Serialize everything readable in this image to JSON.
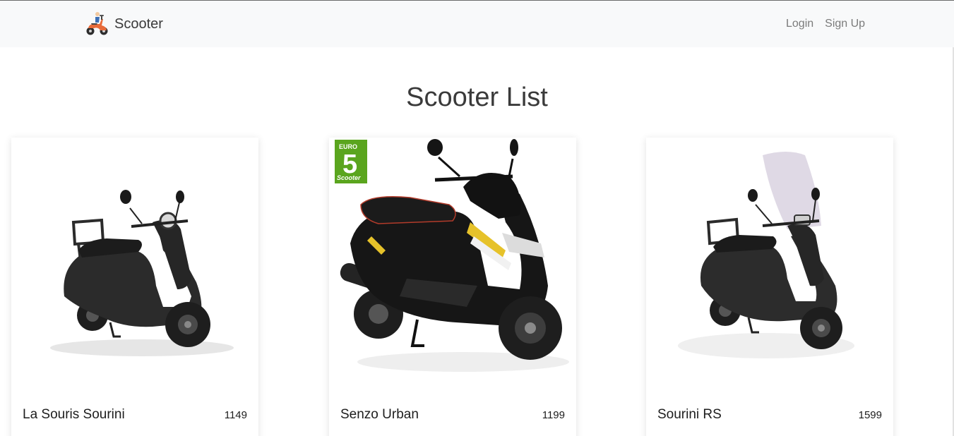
{
  "navbar": {
    "brand": "Scooter",
    "links": [
      "Login",
      "Sign Up"
    ]
  },
  "page": {
    "title": "Scooter List"
  },
  "scooters": [
    {
      "name": "La Souris Sourini",
      "price": "1149"
    },
    {
      "name": "Senzo Urban",
      "price": "1199",
      "badge": {
        "top": "EURO",
        "number": "5",
        "bottom": "Scooter"
      }
    },
    {
      "name": "Sourini RS",
      "price": "1599"
    }
  ],
  "colors": {
    "navbar_bg": "#f8f9fa",
    "badge_green": "#5aa51e",
    "scooter_body": "#2b2b2b"
  }
}
